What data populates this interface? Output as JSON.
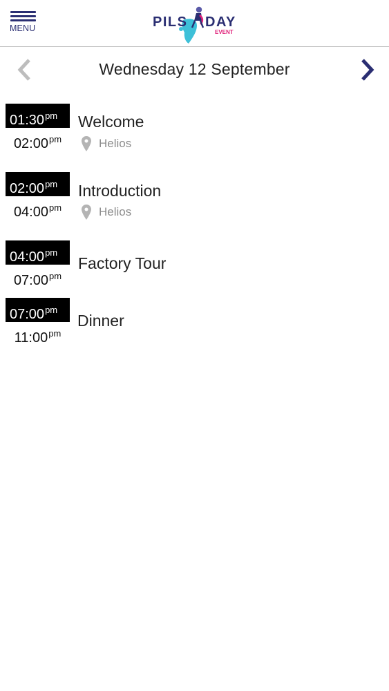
{
  "header": {
    "menu_label": "MENU",
    "logo": {
      "text_left": "PILS",
      "text_right": "DAY",
      "subtext": "EVENT",
      "colors": {
        "navy": "#2a2e72",
        "pink": "#e0217a",
        "cyan": "#3ec0d8"
      }
    }
  },
  "date_nav": {
    "date_label": "Wednesday 12 September",
    "prev_icon": "chevron-left-icon",
    "next_icon": "chevron-right-icon",
    "prev_color": "#bdbdbd",
    "next_color": "#2a2e72"
  },
  "sessions": [
    {
      "start": "01:30",
      "start_ampm": "pm",
      "end": "02:00",
      "end_ampm": "pm",
      "title": "Welcome",
      "location": "Helios"
    },
    {
      "start": "02:00",
      "start_ampm": "pm",
      "end": "04:00",
      "end_ampm": "pm",
      "title": "Introduction",
      "location": "Helios"
    },
    {
      "start": "04:00",
      "start_ampm": "pm",
      "end": "07:00",
      "end_ampm": "pm",
      "title": "Factory Tour",
      "location": ""
    },
    {
      "start": "07:00",
      "start_ampm": "pm",
      "end": "11:00",
      "end_ampm": "pm",
      "title": "Dinner",
      "location": ""
    }
  ]
}
